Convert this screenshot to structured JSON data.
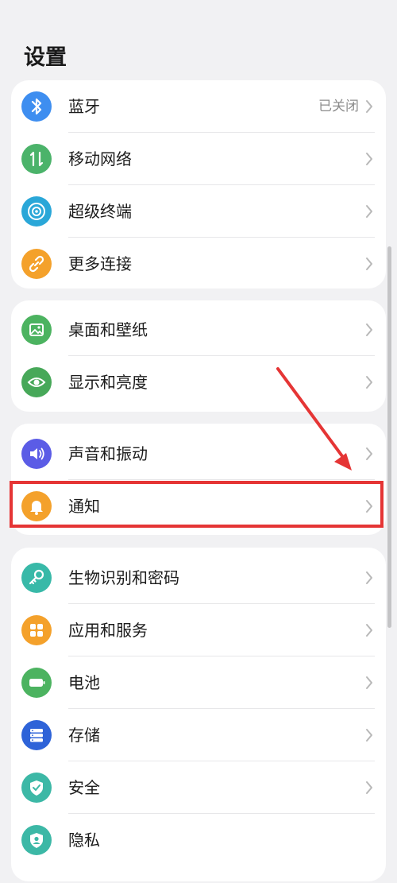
{
  "header": {
    "title": "设置"
  },
  "colors": {
    "bluetooth": "#3e8ef0",
    "mobile": "#4bb36a",
    "super": "#2aa7d8",
    "more": "#f4a12b",
    "wallpaper": "#4cb360",
    "display": "#47a859",
    "sound": "#5b5ce6",
    "notify": "#f4a12b",
    "bio": "#38b9a8",
    "apps": "#f4a12b",
    "battery": "#4cb360",
    "storage": "#2e63d8",
    "security": "#3cb8a6",
    "privacy": "#3cb8a6",
    "highlight": "#e53535"
  },
  "groups": [
    {
      "items": [
        {
          "label": "蓝牙",
          "value": "已关闭",
          "icon": "bluetooth-icon"
        },
        {
          "label": "移动网络",
          "icon": "mobile-network-icon"
        },
        {
          "label": "超级终端",
          "icon": "super-device-icon"
        },
        {
          "label": "更多连接",
          "icon": "link-icon"
        }
      ]
    },
    {
      "items": [
        {
          "label": "桌面和壁纸",
          "icon": "wallpaper-icon"
        },
        {
          "label": "显示和亮度",
          "icon": "eye-icon"
        }
      ]
    },
    {
      "items": [
        {
          "label": "声音和振动",
          "icon": "speaker-icon"
        },
        {
          "label": "通知",
          "icon": "bell-icon"
        }
      ]
    },
    {
      "items": [
        {
          "label": "生物识别和密码",
          "icon": "key-icon"
        },
        {
          "label": "应用和服务",
          "icon": "apps-grid-icon"
        },
        {
          "label": "电池",
          "icon": "battery-icon"
        },
        {
          "label": "存储",
          "icon": "storage-icon"
        },
        {
          "label": "安全",
          "icon": "shield-icon"
        },
        {
          "label": "隐私",
          "icon": "privacy-icon"
        }
      ]
    }
  ]
}
